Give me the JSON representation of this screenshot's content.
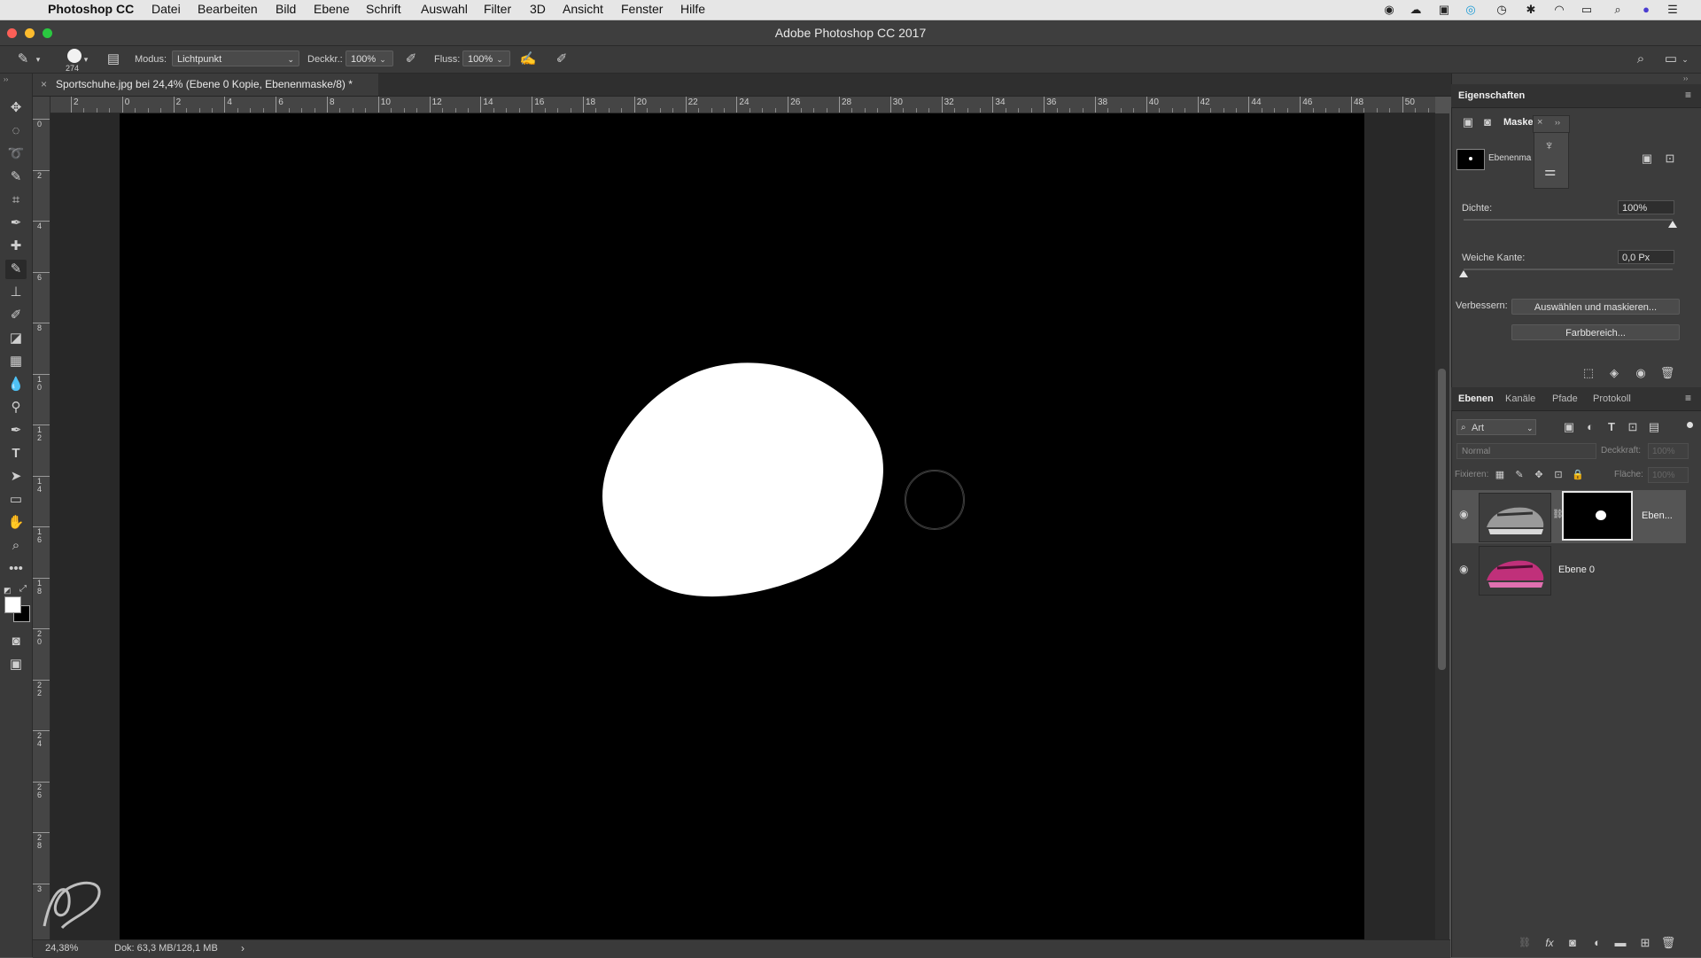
{
  "menubar": {
    "apple_icon": "apple-icon",
    "app_name": "Photoshop CC",
    "items": [
      "Datei",
      "Bearbeiten",
      "Bild",
      "Ebene",
      "Schrift",
      "Auswahl",
      "Filter",
      "3D",
      "Ansicht",
      "Fenster",
      "Hilfe"
    ]
  },
  "window": {
    "title": "Adobe Photoshop CC 2017"
  },
  "options": {
    "brush_size": "274",
    "mode_label": "Modus:",
    "mode_value": "Lichtpunkt",
    "opacity_label": "Deckkr.:",
    "opacity_value": "100%",
    "flow_label": "Fluss:",
    "flow_value": "100%"
  },
  "document": {
    "tab_title": "Sportschuhe.jpg bei 24,4% (Ebene 0 Kopie, Ebenenmaske/8) *",
    "zoom": "24,38%",
    "doc_info": "Dok: 63,3 MB/128,1 MB"
  },
  "rulers": {
    "h_ticks": [
      "2",
      "0",
      "2",
      "4",
      "6",
      "8",
      "10",
      "12",
      "14",
      "16",
      "18",
      "20",
      "22",
      "24",
      "26",
      "28",
      "30",
      "32",
      "34",
      "36",
      "38",
      "40",
      "42",
      "44",
      "46",
      "48",
      "50"
    ],
    "v_ticks": [
      "0",
      "2",
      "4",
      "6",
      "8",
      "10",
      "12",
      "14",
      "16",
      "18",
      "20",
      "22",
      "24",
      "26",
      "28",
      "3"
    ]
  },
  "properties": {
    "title": "Eigenschaften",
    "mask_tab": "Maske",
    "mask_name": "Ebenenma",
    "density_label": "Dichte:",
    "density_value": "100%",
    "density_level": 1.0,
    "feather_label": "Weiche Kante:",
    "feather_value": "0,0 Px",
    "feather_level": 0.0,
    "refine_label": "Verbessern:",
    "select_mask_button": "Auswählen und maskieren...",
    "color_range_button": "Farbbereich..."
  },
  "layers_panel": {
    "tabs": [
      "Ebenen",
      "Kanäle",
      "Pfade",
      "Protokoll"
    ],
    "filter_label": "Art",
    "blend_mode": "Normal",
    "opacity_label": "Deckkraft:",
    "opacity_value": "100%",
    "lock_label": "Fixieren:",
    "fill_label": "Fläche:",
    "fill_value": "100%",
    "layers": [
      {
        "name": "Eben...",
        "has_mask": true,
        "selected": true
      },
      {
        "name": "Ebene 0",
        "has_mask": false,
        "selected": false
      }
    ]
  },
  "colors": {
    "accent": "#e8e8e8",
    "thumb_shoe_gray": "#9a9a9a",
    "thumb_shoe_pink": "#c0307a"
  }
}
